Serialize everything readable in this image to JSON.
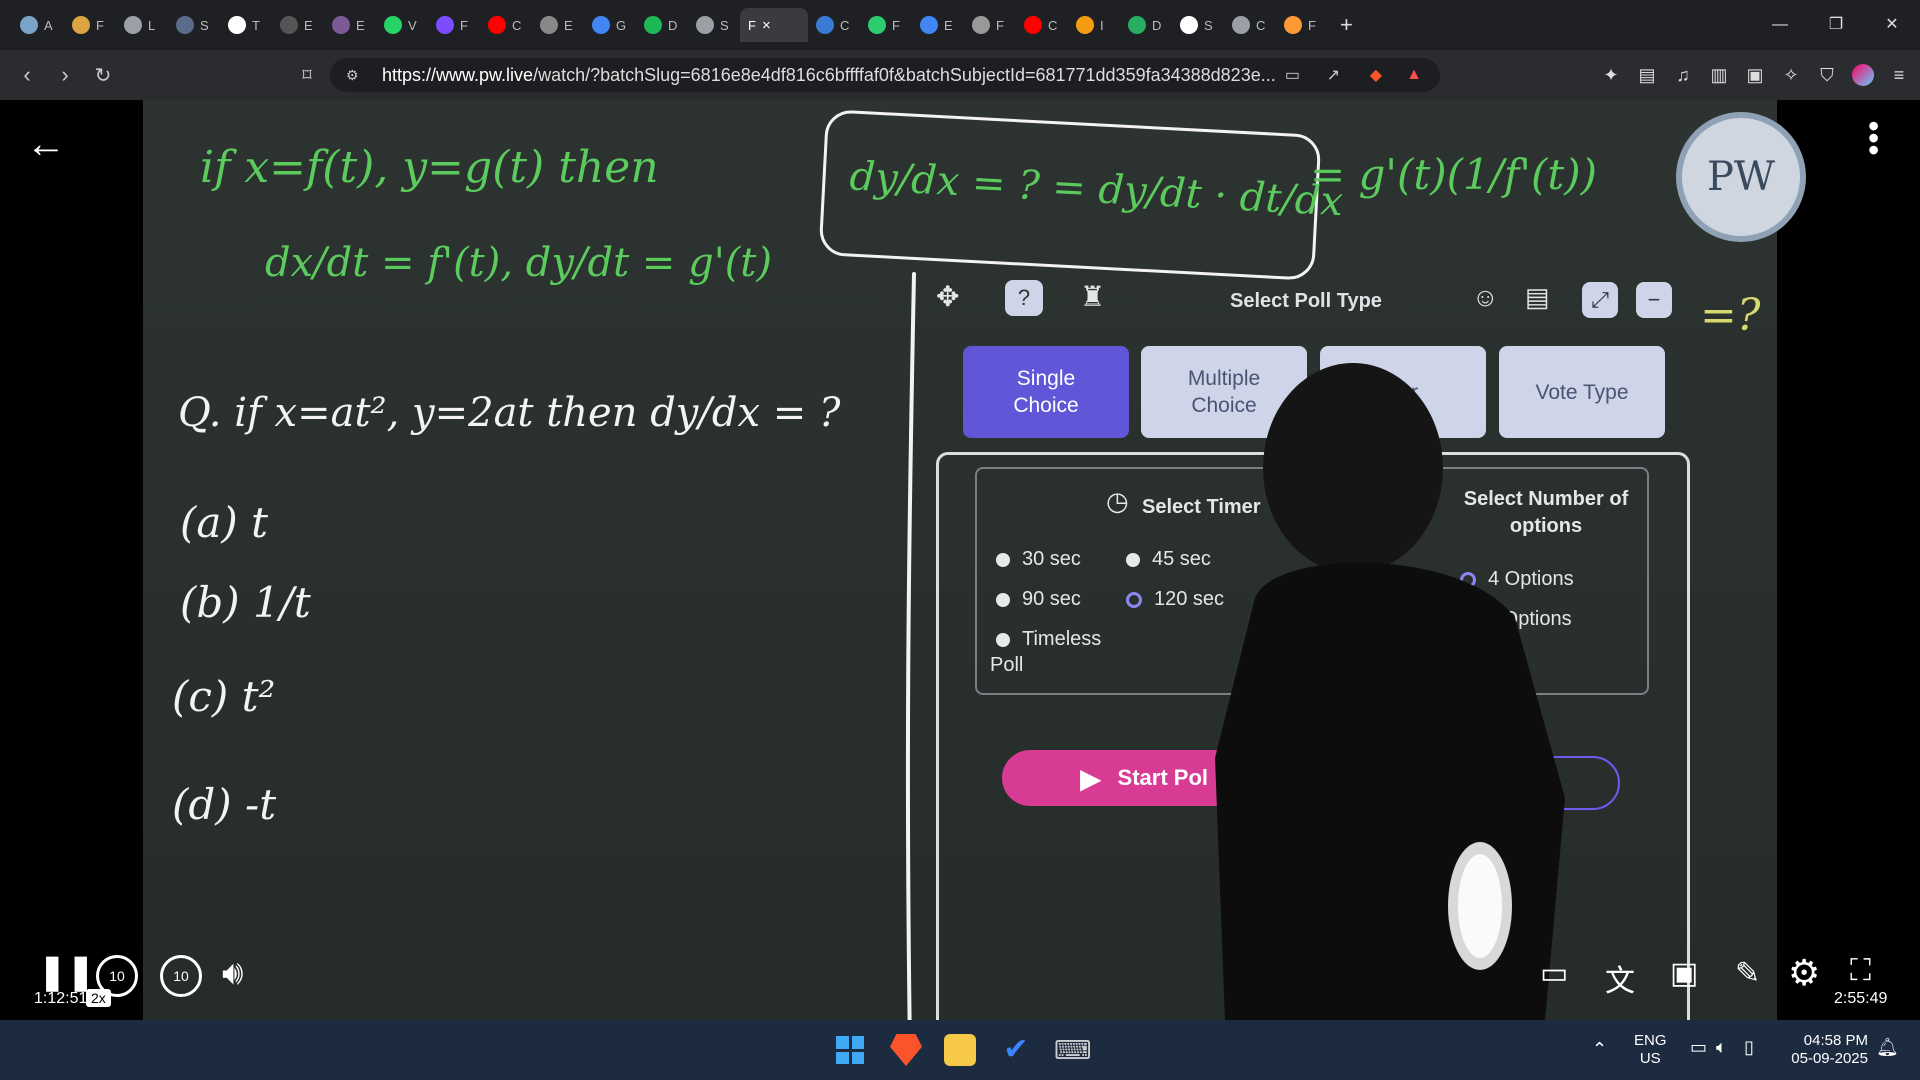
{
  "browser": {
    "tabs": [
      {
        "label": "A",
        "color": "#7aa3c9"
      },
      {
        "label": "F",
        "color": "#d9a441"
      },
      {
        "label": "L",
        "color": "#9aa0a6"
      },
      {
        "label": "S",
        "color": "#5a6b8c"
      },
      {
        "label": "T",
        "color": "#ffffff"
      },
      {
        "label": "E",
        "color": "#555"
      },
      {
        "label": "E",
        "color": "#7c5a96"
      },
      {
        "label": "V",
        "color": "#25d366"
      },
      {
        "label": "F",
        "color": "#7b4dff"
      },
      {
        "label": "C",
        "color": "#ff0000"
      },
      {
        "label": "E",
        "color": "#888"
      },
      {
        "label": "G",
        "color": "#4285f4"
      },
      {
        "label": "D",
        "color": "#1db954"
      },
      {
        "label": "S",
        "color": "#9aa0a6"
      }
    ],
    "active_tab": {
      "label": "F",
      "close_label": "×"
    },
    "tabs_after": [
      {
        "label": "C",
        "color": "#3a7bd5"
      },
      {
        "label": "F",
        "color": "#2ecc71"
      },
      {
        "label": "E",
        "color": "#4285f4"
      },
      {
        "label": "F",
        "color": "#999"
      },
      {
        "label": "C",
        "color": "#ff0000"
      },
      {
        "label": "I",
        "color": "#f39c12"
      },
      {
        "label": "D",
        "color": "#27ae60"
      },
      {
        "label": "S",
        "color": "#ffffff"
      },
      {
        "label": "C",
        "color": "#9aa0a6"
      },
      {
        "label": "F",
        "color": "#ff9933"
      }
    ],
    "new_tab_label": "+",
    "url_host": "https://www.pw.live",
    "url_path": "/watch/?batchSlug=6816e8e4df816c6bffffaf0f&batchSubjectId=681771dd359fa34388d823e..."
  },
  "board": {
    "line1": "if x=f(t), y=g(t) then",
    "box_expr": "dy/dx = ? = dy/dt · dt/dx",
    "rhs": "= g'(t)(1/f'(t))",
    "line2": "dx/dt = f'(t), dy/dt = g'(t)",
    "question": "Q. if x=at², y=2at then dy/dx = ?",
    "opt_a": "(a) t",
    "opt_b": "(b) 1/t",
    "opt_c": "(c) t²",
    "opt_d": "(d) -t",
    "side_mark": "=?",
    "logo": "PW"
  },
  "poll": {
    "title": "Select Poll Type",
    "types": [
      {
        "label": "Single Choice",
        "selected": true
      },
      {
        "label": "Multiple Choice",
        "selected": false
      },
      {
        "label": "ger",
        "selected": false
      },
      {
        "label": "Vote Type",
        "selected": false
      }
    ],
    "timer_title": "Select Timer",
    "timers": [
      "30 sec",
      "45 sec",
      "90 sec",
      "120 sec",
      "Timeless Poll"
    ],
    "options_title": "Select Number of options",
    "options": [
      "4 Options",
      "5 Options"
    ],
    "start_label": "Start Pol"
  },
  "player": {
    "current_time": "1:12:51",
    "speed": "2x",
    "duration": "2:55:49",
    "progress": 0.415,
    "seek_back": "10",
    "seek_fwd": "10"
  },
  "taskbar": {
    "lang": "ENG",
    "region": "US",
    "time": "04:58 PM",
    "date": "05-09-2025"
  }
}
